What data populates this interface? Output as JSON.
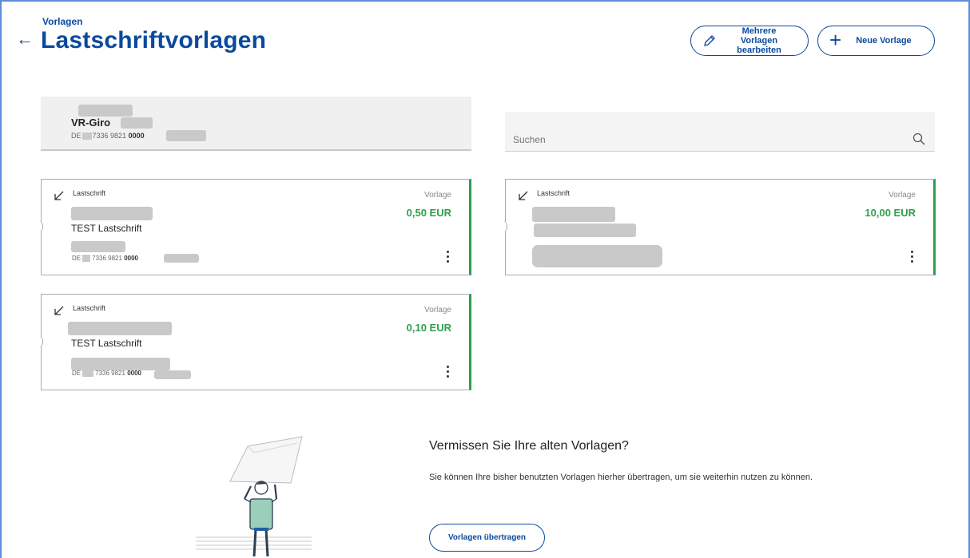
{
  "header": {
    "breadcrumb": "Vorlagen",
    "title": "Lastschriftvorlagen",
    "back_icon": "arrow-left-icon",
    "edit_multiple_line1": "Mehrere Vorlagen",
    "edit_multiple_line2": "bearbeiten",
    "new_template": "Neue Vorlage"
  },
  "account": {
    "name": "VR-Giro",
    "iban_prefix": "DE",
    "iban_middle": "7336 9821",
    "iban_bold": "0000"
  },
  "search": {
    "placeholder": "Suchen"
  },
  "cards": [
    {
      "type": "Lastschrift",
      "status": "Vorlage",
      "amount": "0,50 EUR",
      "reference": "TEST Lastschrift",
      "iban_prefix": "DE",
      "iban_middle": "7336 9821",
      "iban_bold": "0000"
    },
    {
      "type": "Lastschrift",
      "status": "Vorlage",
      "amount": "10,00 EUR"
    },
    {
      "type": "Lastschrift",
      "status": "Vorlage",
      "amount": "0,10 EUR",
      "reference": "TEST Lastschrift",
      "iban_prefix": "DE",
      "iban_middle": "7336 9821",
      "iban_bold": "0000"
    }
  ],
  "promo": {
    "title": "Vermissen Sie Ihre alten Vorlagen?",
    "text": "Sie können Ihre bisher benutzten Vorlagen hierher übertragen, um sie weiterhin nutzen zu können.",
    "button": "Vorlagen übertragen"
  },
  "colors": {
    "brand_blue": "#0a4a9e",
    "amount_green": "#2e9e4f"
  }
}
